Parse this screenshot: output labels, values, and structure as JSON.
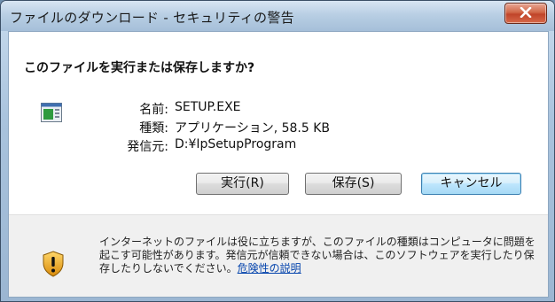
{
  "window": {
    "title": "ファイルのダウンロード - セキュリティの警告"
  },
  "dialog": {
    "heading": "このファイルを実行または保存しますか?",
    "file": {
      "name_label": "名前:",
      "name_value": "SETUP.EXE",
      "type_label": "種類:",
      "type_value": "アプリケーション, 58.5 KB",
      "source_label": "発信元:",
      "source_value": "D:¥IpSetupProgram"
    },
    "buttons": {
      "run": "実行(R)",
      "save": "保存(S)",
      "cancel": "キャンセル"
    },
    "warning": {
      "text": "インターネットのファイルは役に立ちますが、このファイルの種類はコンピュータに問題を起こす可能性があります。発信元が信頼できない場合は、このソフトウェアを実行したり保存したりしないでください。",
      "link": "危険性の説明"
    }
  },
  "colors": {
    "close_button": "#c0452a",
    "link": "#0645ad",
    "shield": "#e0a010"
  }
}
